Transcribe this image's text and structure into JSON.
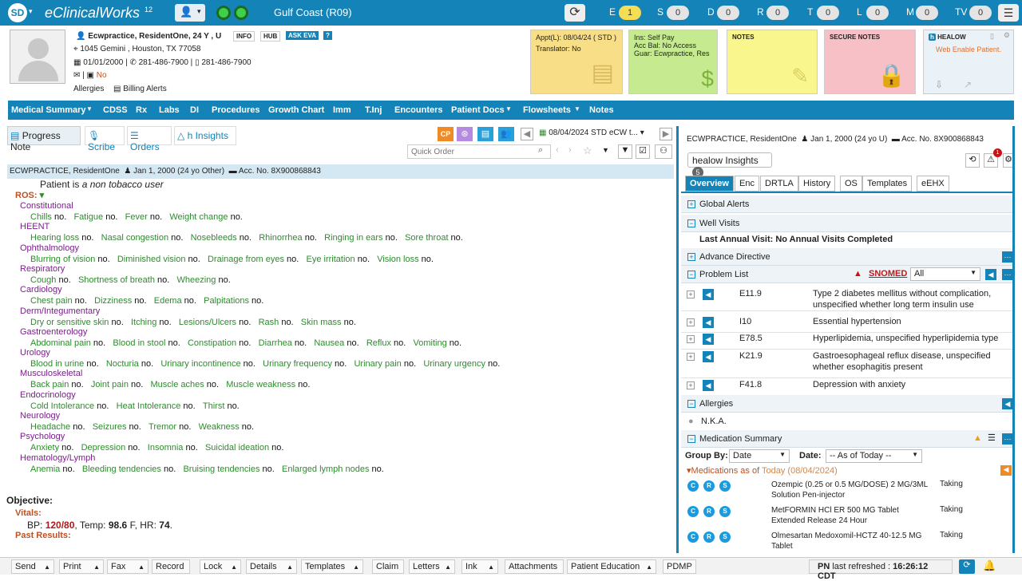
{
  "app": {
    "badge": "SD",
    "name": "eClinicalWorks",
    "version": "12",
    "clinic": "Gulf Coast (R09)"
  },
  "jellybeans": [
    {
      "k": "E",
      "v": "1"
    },
    {
      "k": "S",
      "v": "0"
    },
    {
      "k": "D",
      "v": "0"
    },
    {
      "k": "R",
      "v": "0"
    },
    {
      "k": "T",
      "v": "0"
    },
    {
      "k": "L",
      "v": "0"
    },
    {
      "k": "M",
      "v": "0"
    },
    {
      "k": "TV",
      "v": "0"
    }
  ],
  "patient": {
    "name": "Ecwpractice, ResidentOne",
    "age": ", 24 Y , U",
    "info": "INFO",
    "hub": "HUB",
    "eva": "ASK EVA",
    "help": "?",
    "address": "1045 Gemini , Houston, TX 77058",
    "dob": "01/01/2000",
    "phone1": "281-486-7900",
    "phone2": "281-486-7900",
    "no": "No",
    "allergies": "Allergies",
    "billing": "Billing Alerts"
  },
  "boxes": {
    "appt": "Appt(L): 08/04/24 ( STD )",
    "translator": "Translator: No",
    "ins": "Ins: Self Pay",
    "accbal": "Acc Bal: No Access",
    "guar": "Guar: Ecwpractice, Res",
    "notes": "NOTES",
    "secure": "SECURE NOTES",
    "healow": "HEALOW",
    "webenable": "Web Enable Patient."
  },
  "nav": [
    "Medical Summary",
    "CDSS",
    "Rx",
    "Labs",
    "DI",
    "Procedures",
    "Growth Chart",
    "Imm",
    "T.Inj",
    "Encounters",
    "Patient Docs",
    "Flowsheets",
    "Notes"
  ],
  "left": {
    "tabs": [
      "Progress Note",
      "Scribe",
      "Orders",
      "h Insights"
    ],
    "enc_date": "08/04/2024 STD eCW t...",
    "quick_order": "Quick Order",
    "banner_name": "ECWPRACTICE, ResidentOne",
    "banner_dob": "Jan 1, 2000 (24 yo Other)",
    "banner_acc": "Acc. No. 8X900868843",
    "tobacco_pre": "Patient is",
    "tobacco": "a non tobacco user",
    "ros": "ROS:",
    "objective": "Objective:",
    "vitals": "Vitals:",
    "bp_lbl": "BP:",
    "bp": "120/80",
    "temp_lbl": ", Temp:",
    "temp": "98.6",
    "f": "F, HR:",
    "hr": "74",
    "past": "Past Results:"
  },
  "ros": [
    {
      "cat": "Constitutional",
      "items": [
        "Chills",
        "Fatigue",
        "Fever",
        "Weight change"
      ]
    },
    {
      "cat": "HEENT",
      "items": [
        "Hearing loss",
        "Nasal congestion",
        "Nosebleeds",
        "Rhinorrhea",
        "Ringing in ears",
        "Sore throat"
      ]
    },
    {
      "cat": "Ophthalmology",
      "items": [
        "Blurring of vision",
        "Diminished vision",
        "Drainage from eyes",
        "Eye irritation",
        "Vision loss"
      ]
    },
    {
      "cat": "Respiratory",
      "items": [
        "Cough",
        "Shortness of breath",
        "Wheezing"
      ]
    },
    {
      "cat": "Cardiology",
      "items": [
        "Chest pain",
        "Dizziness",
        "Edema",
        "Palpitations"
      ]
    },
    {
      "cat": "Derm/Integumentary",
      "items": [
        "Dry or sensitive skin",
        "Itching",
        "Lesions/Ulcers",
        "Rash",
        "Skin mass"
      ]
    },
    {
      "cat": "Gastroenterology",
      "items": [
        "Abdominal pain",
        "Blood in stool",
        "Constipation",
        "Diarrhea",
        "Nausea",
        "Reflux",
        "Vomiting"
      ]
    },
    {
      "cat": "Urology",
      "items": [
        "Blood in urine",
        "Nocturia",
        "Urinary incontinence",
        "Urinary frequency",
        "Urinary pain",
        "Urinary urgency"
      ]
    },
    {
      "cat": "Musculoskeletal",
      "items": [
        "Back pain",
        "Joint pain",
        "Muscle aches",
        "Muscle weakness"
      ]
    },
    {
      "cat": "Endocrinology",
      "items": [
        "Cold Intolerance",
        "Heat Intolerance",
        "Thirst"
      ]
    },
    {
      "cat": "Neurology",
      "items": [
        "Headache",
        "Seizures",
        "Tremor",
        "Weakness"
      ]
    },
    {
      "cat": "Psychology",
      "items": [
        "Anxiety",
        "Depression",
        "Insomnia",
        "Suicidal ideation"
      ]
    },
    {
      "cat": "Hematology/Lymph",
      "items": [
        "Anemia",
        "Bleeding tendencies",
        "Bruising tendencies",
        "Enlarged lymph nodes"
      ]
    }
  ],
  "right": {
    "name": "ECWPRACTICE, ResidentOne",
    "dob": "Jan 1, 2000 (24 yo U)",
    "acc": "Acc. No. 8X900868843",
    "insights": "healow Insights",
    "insights_count": "5",
    "alert_count": "1",
    "tabs": [
      "Overview",
      "Enc",
      "DRTLA",
      "History",
      "OS",
      "Templates",
      "eEHX"
    ],
    "global": "Global Alerts",
    "well": "Well Visits",
    "last_annual": "Last Annual Visit: No Annual Visits Completed",
    "advance": "Advance Directive",
    "problem": "Problem List",
    "snomed": "SNOMED",
    "filter": "All",
    "problems": [
      {
        "code": "E11.9",
        "desc": "Type 2 diabetes mellitus without complication, unspecified whether long term insulin use"
      },
      {
        "code": "I10",
        "desc": "Essential hypertension"
      },
      {
        "code": "E78.5",
        "desc": "Hyperlipidemia, unspecified hyperlipidemia type"
      },
      {
        "code": "K21.9",
        "desc": "Gastroesophageal reflux disease, unspecified whether esophagitis present"
      },
      {
        "code": "F41.8",
        "desc": "Depression with anxiety"
      }
    ],
    "allergies": "Allergies",
    "nka": "N.K.A.",
    "medsum": "Medication Summary",
    "groupby": "Group By:",
    "groupval": "Date",
    "date_lbl": "Date:",
    "dateval": "-- As of Today --",
    "meds_as_of": "Medications as of",
    "today": "Today (08/04/2024)",
    "meds": [
      {
        "name": "Ozempic (0.25 or 0.5 MG/DOSE) 2 MG/3ML Solution Pen-injector",
        "status": "Taking"
      },
      {
        "name": "MetFORMIN HCl ER 500 MG Tablet Extended Release 24 Hour",
        "status": "Taking"
      },
      {
        "name": "Olmesartan Medoxomil-HCTZ 40-12.5 MG Tablet",
        "status": "Taking"
      }
    ]
  },
  "bottom": {
    "buttons": [
      "Send",
      "Print",
      "Fax",
      "Record",
      "Lock",
      "Details",
      "Templates",
      "Claim",
      "Letters",
      "Ink",
      "Attachments",
      "Patient Education",
      "PDMP"
    ],
    "pn": "PN",
    "refreshed": "last refreshed :",
    "time": "16:26:12 CDT"
  }
}
